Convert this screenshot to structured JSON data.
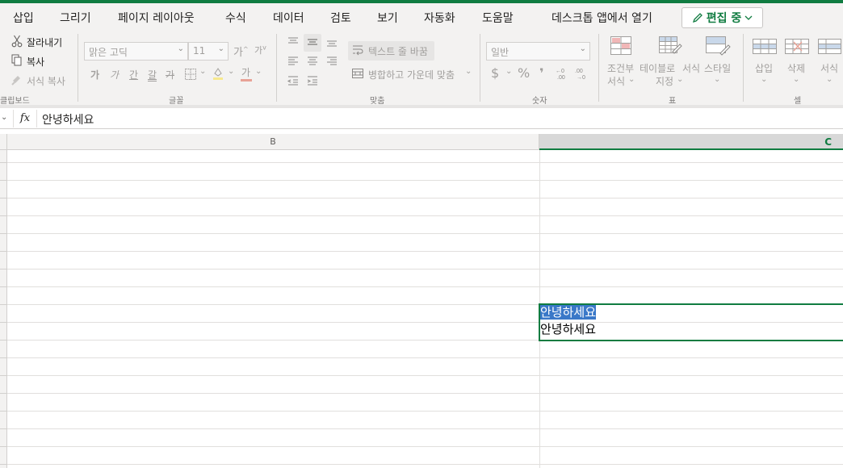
{
  "menu": {
    "tabs": [
      "삽입",
      "그리기",
      "페이지 레이아웃",
      "수식",
      "데이터",
      "검토",
      "보기",
      "자동화",
      "도움말",
      "데스크톱 앱에서 열기"
    ],
    "edit_button_label": "편집 중"
  },
  "ribbon": {
    "clipboard": {
      "cut": "잘라내기",
      "copy": "복사",
      "format_painter": "서식 복사",
      "label": "클립보드"
    },
    "font": {
      "font_name": "맑은 고딕",
      "font_size": "11",
      "bold": "가",
      "italic": "가",
      "underline": "간",
      "double_underline": "갈",
      "strike": "가",
      "increase_size": "가",
      "decrease_size": "가",
      "font_color": "가",
      "label": "글꼴"
    },
    "alignment": {
      "wrap_text": "텍스트 줄 바꿈",
      "merge_center": "병합하고 가운데 맞춤",
      "label": "맞춤"
    },
    "number": {
      "format": "일반",
      "currency": "$",
      "percent": "%",
      "comma": "❜",
      "label": "숫자"
    },
    "styles": {
      "conditional_format_1": "조건부",
      "conditional_format_2": "서식",
      "format_as_table_1": "테이블로",
      "format_as_table_2": "지정",
      "cell_styles_1": "서식",
      "cell_styles_2": "스타일",
      "label": "표"
    },
    "cells": {
      "insert": "삽입",
      "delete": "삭제",
      "format": "서식",
      "label": "셀"
    }
  },
  "formula_bar": {
    "fx": "fx",
    "value": "안녕하세요"
  },
  "columns": {
    "b": "B",
    "c": "C"
  },
  "cells": {
    "c1": "안녕하세요",
    "c2": "안녕하세요"
  },
  "colors": {
    "accent": "#107c41",
    "selection_highlight": "#3a78c8"
  }
}
